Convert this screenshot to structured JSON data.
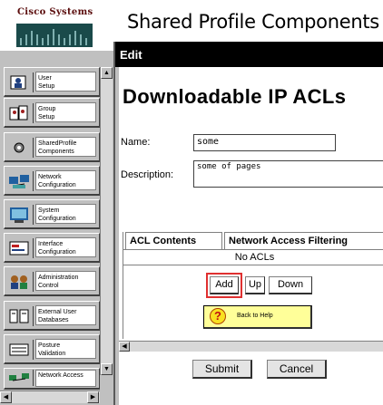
{
  "brand": {
    "company": "Cisco Systems",
    "logo_icon": "cisco-bridge-logo"
  },
  "header": {
    "title": "Shared Profile Components"
  },
  "nav": {
    "items": [
      {
        "line1": "User",
        "line2": "Setup",
        "icon": "user-setup-icon"
      },
      {
        "line1": "Group",
        "line2": "Setup",
        "icon": "group-setup-icon"
      },
      {
        "line1": "SharedProfile",
        "line2": "Components",
        "icon": "shared-profile-icon"
      },
      {
        "line1": "Network",
        "line2": "Configuration",
        "icon": "network-config-icon"
      },
      {
        "line1": "System",
        "line2": "Configuration",
        "icon": "system-config-icon"
      },
      {
        "line1": "Interface",
        "line2": "Configuration",
        "icon": "interface-config-icon"
      },
      {
        "line1": "Administration",
        "line2": "Control",
        "icon": "admin-control-icon"
      },
      {
        "line1": "External User",
        "line2": "Databases",
        "icon": "external-db-icon"
      },
      {
        "line1": "Posture",
        "line2": "Validation",
        "icon": "posture-icon"
      },
      {
        "line1": "Network Access",
        "line2": "",
        "icon": "network-access-icon"
      }
    ]
  },
  "edit": {
    "header": "Edit",
    "form_title": "Downloadable IP ACLs",
    "name_label": "Name:",
    "name_value": "some",
    "description_label": "Description:",
    "description_value": "some of pages",
    "tabs": [
      "ACL Contents",
      "Network Access Filtering"
    ],
    "empty_text": "No ACLs",
    "buttons": {
      "add": "Add",
      "up": "Up",
      "down": "Down"
    },
    "help_label": "Back to Help",
    "submit": "Submit",
    "cancel": "Cancel"
  },
  "colors": {
    "highlight": "#e03030",
    "help_bg": "#ffff99",
    "header_bg": "#000000"
  }
}
